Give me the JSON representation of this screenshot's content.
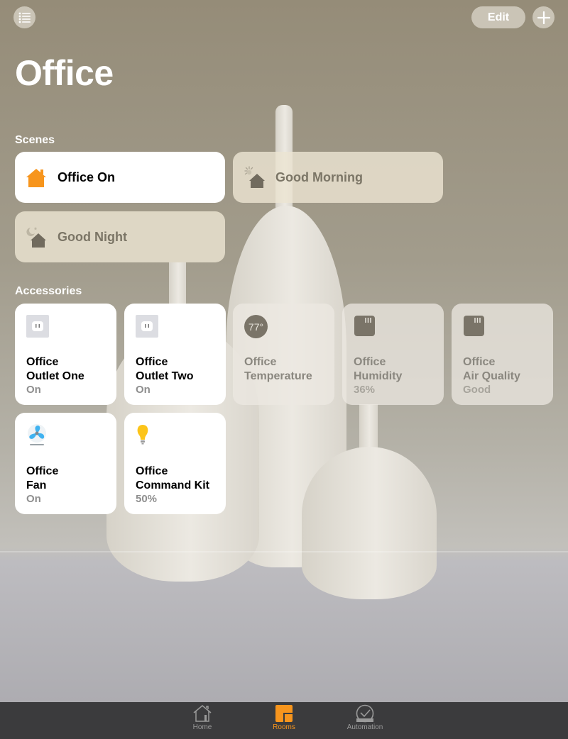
{
  "header": {
    "title": "Office",
    "edit_label": "Edit",
    "add_label": "+",
    "menu_icon": "list-icon"
  },
  "scenes": {
    "label": "Scenes",
    "items": [
      {
        "label": "Office On",
        "icon": "house-icon",
        "state": "on"
      },
      {
        "label": "Good Morning",
        "icon": "sun-house-icon",
        "state": "off"
      },
      {
        "label": "Good Night",
        "icon": "moon-house-icon",
        "state": "off"
      }
    ]
  },
  "accessories": {
    "label": "Accessories",
    "items": [
      {
        "room": "Office",
        "name": "Outlet One",
        "status": "On",
        "icon": "outlet-icon",
        "state": "on"
      },
      {
        "room": "Office",
        "name": "Outlet Two",
        "status": "On",
        "icon": "outlet-icon",
        "state": "on"
      },
      {
        "room": "Office",
        "name": "Temperature",
        "status": "",
        "icon": "thermometer-badge-icon",
        "badge": "77°",
        "state": "off"
      },
      {
        "room": "Office",
        "name": "Humidity",
        "status": "36%",
        "icon": "sensor-icon",
        "state": "off"
      },
      {
        "room": "Office",
        "name": "Air Quality",
        "status": "Good",
        "icon": "sensor-icon",
        "state": "off"
      },
      {
        "room": "Office",
        "name": "Fan",
        "status": "On",
        "icon": "fan-icon",
        "state": "on"
      },
      {
        "room": "Office",
        "name": "Command Kit",
        "status": "50%",
        "icon": "lightbulb-icon",
        "state": "on"
      }
    ]
  },
  "tabbar": {
    "items": [
      {
        "label": "Home",
        "icon": "home-icon",
        "active": false
      },
      {
        "label": "Rooms",
        "icon": "rooms-icon",
        "active": true
      },
      {
        "label": "Automation",
        "icon": "clock-icon",
        "active": false
      }
    ]
  },
  "colors": {
    "accent": "#f7951d",
    "tabbar_bg": "#3b3b3d",
    "bulb": "#fcc419",
    "fan": "#3fb2f0"
  }
}
